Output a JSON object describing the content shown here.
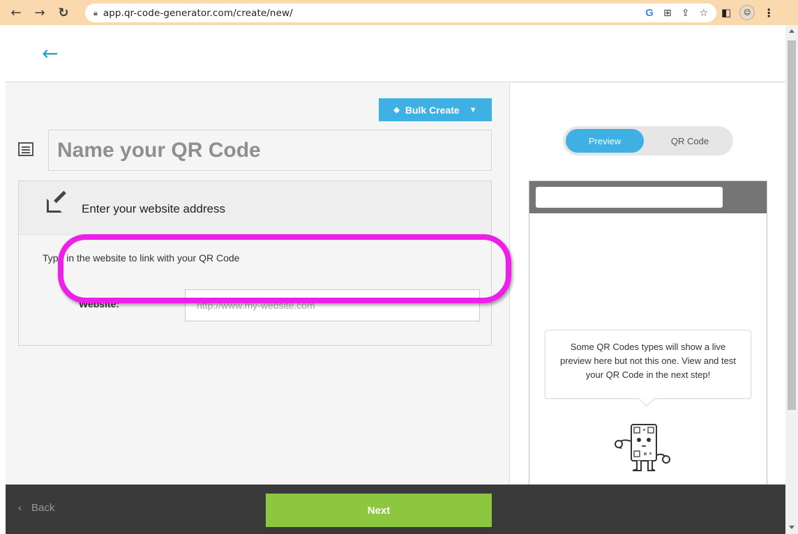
{
  "browser": {
    "url": "app.qr-code-generator.com/create/new/",
    "nav_icons": [
      "back-arrow-icon",
      "forward-arrow-icon",
      "reload-icon"
    ],
    "omnibox_icons": [
      "google-icon",
      "translate-icon",
      "share-icon",
      "star-icon"
    ]
  },
  "header": {
    "back_icon": "left-arrow-icon"
  },
  "form": {
    "bulk_create_label": "Bulk Create",
    "name_placeholder": "Name your QR Code",
    "card_title": "Enter your website address",
    "card_description": "Type in the website to link with your QR Code",
    "website_label": "Website:",
    "website_value": "",
    "website_placeholder": "http://www.my-website.com"
  },
  "preview_panel": {
    "toggle": {
      "preview_label": "Preview",
      "qrcode_label": "QR Code",
      "active": "Preview"
    },
    "message": "Some QR Codes types will show a live preview here but not this one. View and test your QR Code in the next step!"
  },
  "footer": {
    "back_label": "Back",
    "next_label": "Next"
  },
  "colors": {
    "accent_blue": "#3eb0e4",
    "next_green": "#8dc63f",
    "highlight_magenta": "#ee1fe8",
    "footer_bg": "#3a3a3a",
    "chrome_bg": "#f9d9ad"
  }
}
